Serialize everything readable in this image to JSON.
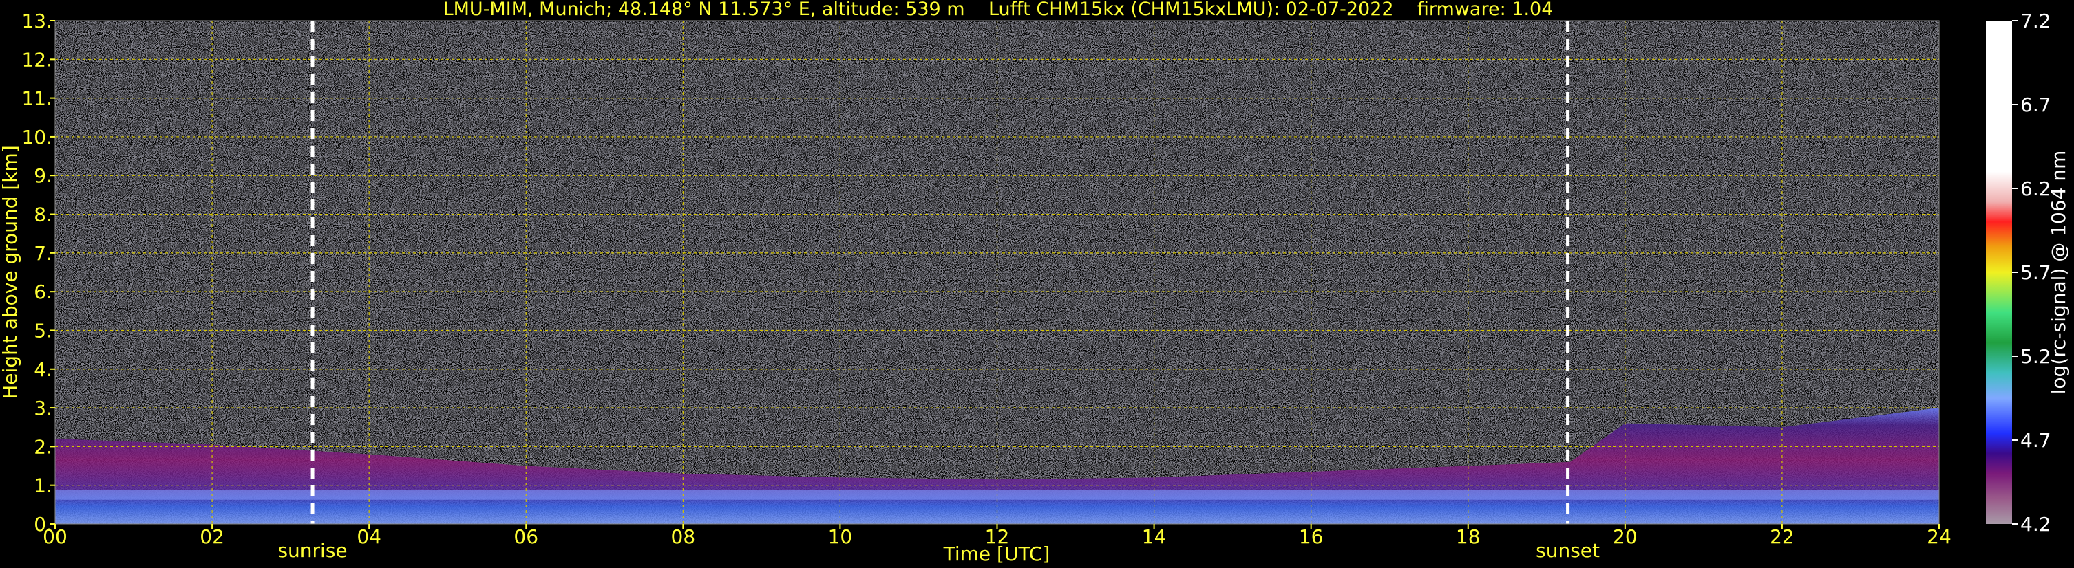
{
  "chart_data": {
    "type": "heatmap",
    "title": "LMU-MIM, Munich; 48.148° N 11.573° E, altitude: 539 m    Lufft CHM15kx (CHM15kxLMU): 02-07-2022    firmware: 1.04",
    "xlabel": "Time [UTC]",
    "ylabel": "Height above ground [km]",
    "x_ticks": [
      "00",
      "02",
      "04",
      "06",
      "08",
      "10",
      "12",
      "14",
      "16",
      "18",
      "20",
      "22",
      "24"
    ],
    "y_ticks": [
      "0.",
      "1.",
      "2.",
      "3.",
      "4.",
      "5.",
      "6.",
      "7.",
      "8.",
      "9.",
      "10.",
      "11.",
      "12.",
      "13."
    ],
    "xlim": [
      0,
      24
    ],
    "ylim": [
      0,
      13
    ],
    "grid": true,
    "annotations": [
      {
        "label": "sunrise",
        "time_h": 3.28
      },
      {
        "label": "sunset",
        "time_h": 19.27
      }
    ],
    "colorbar": {
      "label": "log(rc-signal) @ 1064 nm",
      "ticks": [
        "7.2",
        "6.7",
        "6.2",
        "5.7",
        "5.2",
        "4.7",
        "4.2"
      ],
      "range": [
        4.2,
        7.2
      ]
    },
    "boundary_layer_top_km": [
      [
        0,
        2.2
      ],
      [
        2,
        2.05
      ],
      [
        4,
        1.8
      ],
      [
        6,
        1.5
      ],
      [
        8,
        1.3
      ],
      [
        10,
        1.2
      ],
      [
        12,
        1.15
      ],
      [
        14,
        1.2
      ],
      [
        16,
        1.35
      ],
      [
        18,
        1.5
      ],
      [
        19.3,
        1.6
      ],
      [
        20,
        2.6
      ],
      [
        22,
        2.5
      ],
      [
        24,
        3.0
      ]
    ],
    "colors": {
      "text": "#ffff33",
      "grid": "#d4c400",
      "background": "#000000"
    }
  }
}
